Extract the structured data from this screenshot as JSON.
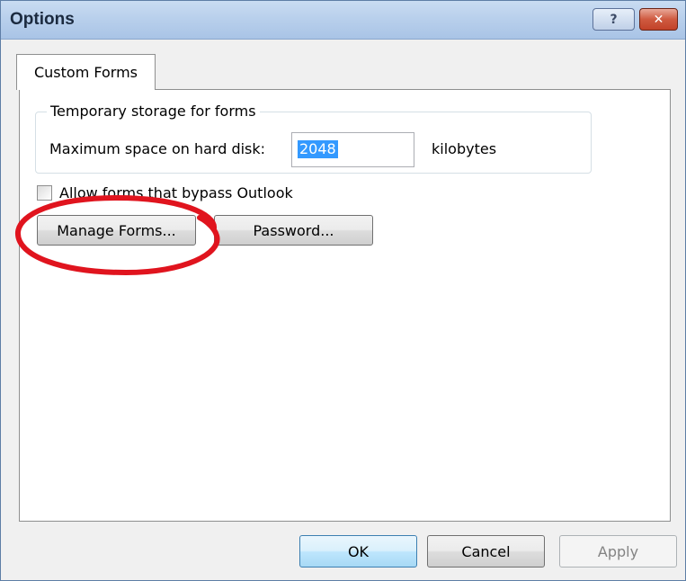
{
  "window": {
    "title": "Options",
    "help_glyph": "?",
    "close_glyph": "✕"
  },
  "tabs": [
    {
      "label": "Custom Forms"
    }
  ],
  "storage_group": {
    "legend": "Temporary storage for forms",
    "max_space_label": "Maximum space on hard disk:",
    "max_space_value": "2048",
    "unit_label": "kilobytes"
  },
  "allow_bypass": {
    "label": "Allow forms that bypass Outlook",
    "checked": false
  },
  "buttons": {
    "manage_forms": "Manage Forms...",
    "password": "Password...",
    "ok": "OK",
    "cancel": "Cancel",
    "apply": "Apply"
  },
  "annotation": {
    "color": "#e0141e",
    "target": "manage-forms-button"
  }
}
